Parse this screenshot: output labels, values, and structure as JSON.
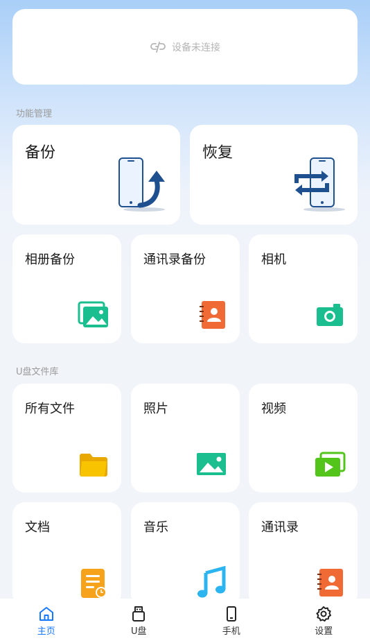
{
  "device_status": {
    "text": "设备未连接",
    "icon": "disconnected-link-icon"
  },
  "sections": {
    "functions": "功能管理",
    "udisk": "U盘文件库"
  },
  "functions": {
    "backup": "备份",
    "restore": "恢复",
    "album_backup": "相册备份",
    "contacts_backup": "通讯录备份",
    "camera": "相机"
  },
  "library": {
    "all_files": "所有文件",
    "photos": "照片",
    "videos": "视频",
    "documents": "文档",
    "music": "音乐",
    "contacts": "通讯录"
  },
  "nav": {
    "home": "主页",
    "udisk": "U盘",
    "phone": "手机",
    "settings": "设置"
  },
  "colors": {
    "accent": "#1677ff",
    "green": "#1bbf8f",
    "orange": "#f06a35",
    "yellow": "#f8c300",
    "lime": "#52c41a",
    "amber": "#f7a21b",
    "sky": "#2bb4f0"
  }
}
